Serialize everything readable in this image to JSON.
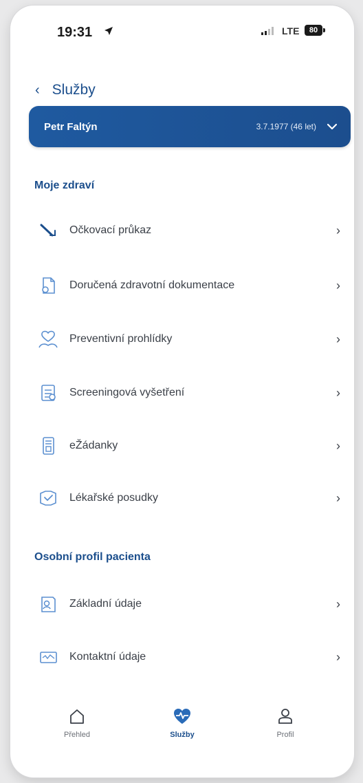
{
  "status_bar": {
    "time": "19:31",
    "network": "LTE",
    "battery": "80"
  },
  "header": {
    "back_title": "Služby"
  },
  "patient": {
    "name": "Petr Faltýn",
    "dob": "3.7.1977 (46 let)"
  },
  "sections": [
    {
      "title": "Moje zdraví",
      "items": [
        {
          "label": "Očkovací průkaz",
          "icon": "syringe-icon"
        },
        {
          "label": "Doručená zdravotní dokumentace",
          "icon": "document-icon"
        },
        {
          "label": "Preventivní prohlídky",
          "icon": "checkup-icon"
        },
        {
          "label": "Screeningová vyšetření",
          "icon": "screening-icon"
        },
        {
          "label": "eŽádanky",
          "icon": "request-form-icon"
        },
        {
          "label": "Lékařské posudky",
          "icon": "medical-report-icon"
        }
      ]
    },
    {
      "title": "Osobní profil pacienta",
      "items": [
        {
          "label": "Základní údaje",
          "icon": "profile-card-icon"
        },
        {
          "label": "Kontaktní údaje",
          "icon": "contact-card-icon"
        }
      ]
    }
  ],
  "tabs": [
    {
      "label": "Přehled",
      "icon": "home-icon",
      "active": false
    },
    {
      "label": "Služby",
      "icon": "heart-pulse-icon",
      "active": true
    },
    {
      "label": "Profil",
      "icon": "user-icon",
      "active": false
    }
  ],
  "colors": {
    "accent": "#1b4e8c",
    "patient_bar": "#1f5aa0",
    "text": "#3a3f47"
  }
}
